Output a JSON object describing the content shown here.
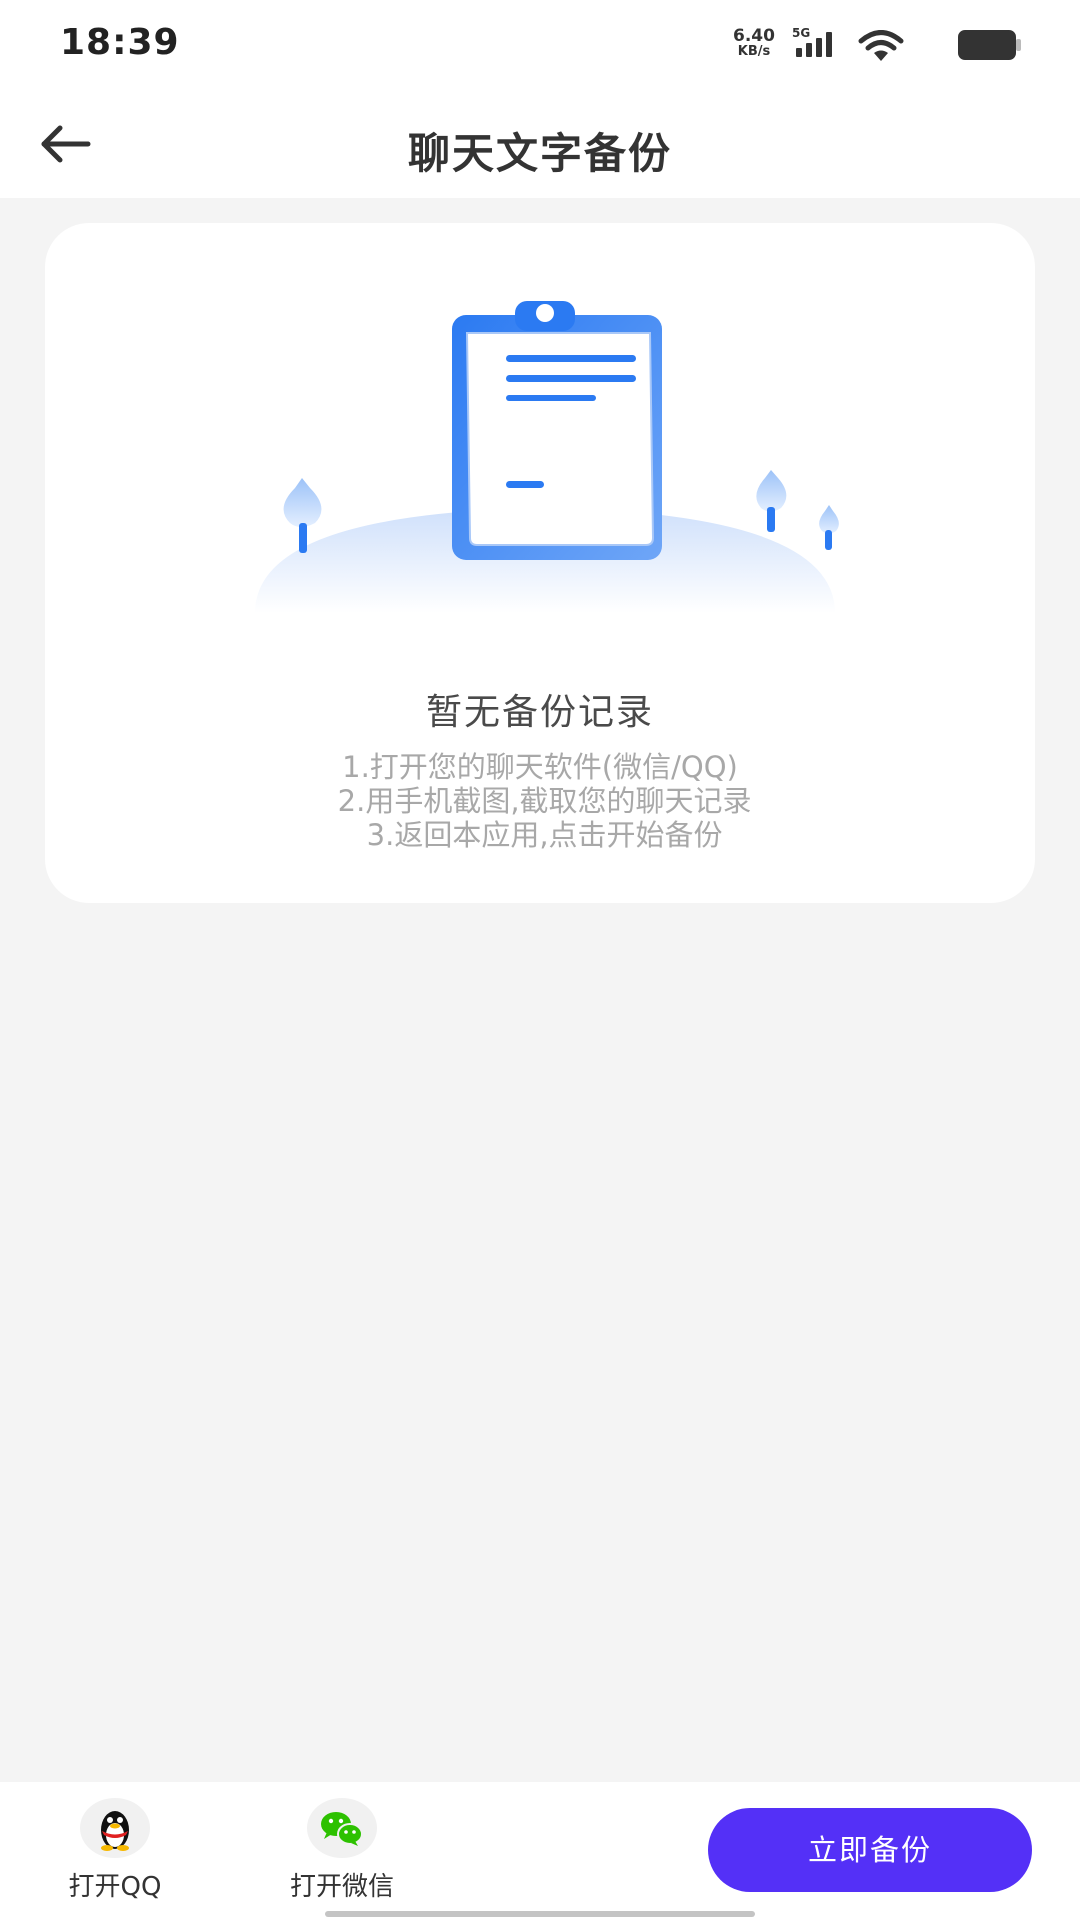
{
  "status_bar": {
    "time": "18:39",
    "net_speed_value": "6.40",
    "net_speed_unit": "KB/s",
    "network_type": "5G"
  },
  "app_bar": {
    "title": "聊天文字备份",
    "back_icon": "arrow-left-icon"
  },
  "empty_state": {
    "illustration": "clipboard-document-icon",
    "title": "暂无备份记录",
    "steps": [
      "1.打开您的聊天软件(微信/QQ)",
      " 2.用手机截图,截取您的聊天记录",
      " 3.返回本应用,点击开始备份"
    ]
  },
  "bottom_bar": {
    "open_qq": {
      "label": "打开QQ",
      "icon": "qq-penguin-icon"
    },
    "open_wechat": {
      "label": "打开微信",
      "icon": "wechat-icon"
    },
    "backup_now": "立即备份"
  },
  "colors": {
    "accent": "#5430f7",
    "illustration_blue": "#2b7af2",
    "wechat_green": "#2dc100",
    "background": "#f4f4f4"
  }
}
